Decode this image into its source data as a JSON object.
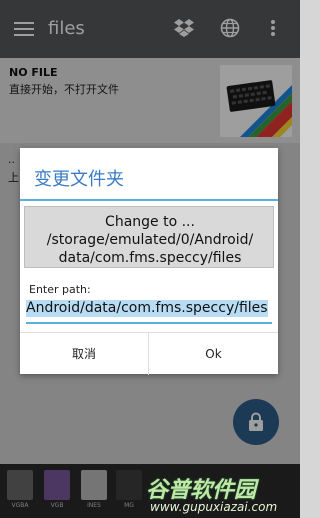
{
  "appbar": {
    "title": "files"
  },
  "file_item": {
    "title": "NO FILE",
    "subtitle": "直接开始，不打开文件"
  },
  "row2": {
    "dots": "..",
    "up": "上"
  },
  "dialog": {
    "title": "变更文件夹",
    "message_lines": [
      "Change to ...",
      "/storage/emulated/0/Android/",
      "data/com.fms.speccy/files"
    ],
    "enter_label": "Enter path:",
    "path_value": "Android/data/com.fms.speccy/files",
    "cancel_label": "取消",
    "ok_label": "Ok"
  },
  "bottom_bar": {
    "items": [
      {
        "label": "VGBA",
        "color": "#6a6a6a"
      },
      {
        "label": "VGB",
        "color": "#7b5aa0"
      },
      {
        "label": "iNES",
        "color": "#bdbdbd"
      },
      {
        "label": "MG",
        "color": "#3e3e3e"
      },
      {
        "label": "",
        "color": "#4a4a4a"
      }
    ]
  },
  "watermark": {
    "text": "谷普软件园",
    "url": "www.gupuxiazai.com"
  },
  "colors": {
    "appbar": "#58595b",
    "accent": "#3a7cc5",
    "fab": "#2e5d8c"
  }
}
